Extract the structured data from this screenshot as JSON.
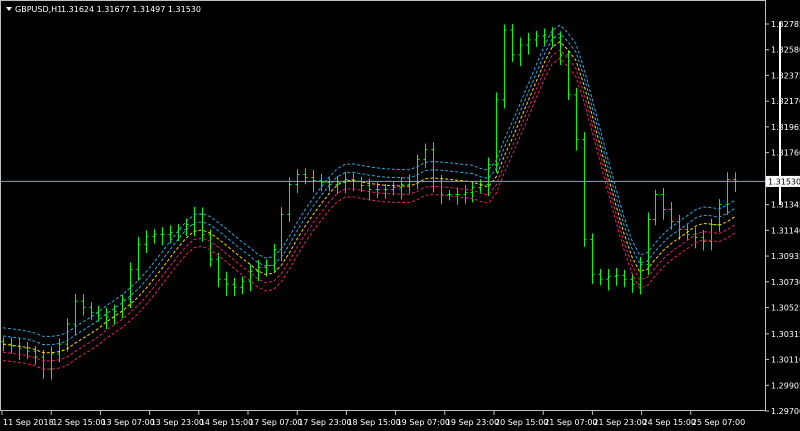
{
  "header": {
    "symbol": "GBPUSD,H1",
    "ohlc": "1.31624 1.31677 1.31497 1.31530",
    "menu_icon": "triangle-down-icon"
  },
  "colors": {
    "background": "#000000",
    "bars": "#00ff00",
    "moving_average": "#ffd700",
    "upper_envelope": "#29a8e0",
    "lower_envelope": "#e0245e",
    "current_price_line": "#8fa3b8",
    "axis": "#c0c0c0"
  },
  "chart_data": {
    "type": "bar",
    "title": "GBPUSD,H1",
    "ylim": [
      1.297,
      1.32785
    ],
    "yticks": [
      "1.32785",
      "1.32580",
      "1.32375",
      "1.32170",
      "1.31965",
      "1.31760",
      "1.31345",
      "1.31140",
      "1.30935",
      "1.30730",
      "1.30525",
      "1.30315",
      "1.30110",
      "1.29905",
      "1.29700"
    ],
    "current_price": "1.31530",
    "xticks": [
      "11 Sep 2018",
      "12 Sep 15:00",
      "13 Sep 07:00",
      "13 Sep 23:00",
      "14 Sep 15:00",
      "17 Sep 07:00",
      "17 Sep 23:00",
      "18 Sep 15:00",
      "19 Sep 07:00",
      "19 Sep 23:00",
      "20 Sep 15:00",
      "21 Sep 07:00",
      "21 Sep 23:00",
      "24 Sep 15:00",
      "25 Sep 07:00"
    ],
    "grid": false,
    "series": [
      {
        "type": "ohlc-bars",
        "close": [
          1.30233,
          1.30217,
          1.30201,
          1.30177,
          1.3013,
          1.30034,
          1.30154,
          1.30233,
          1.30392,
          1.30575,
          1.30527,
          1.30487,
          1.30464,
          1.30448,
          1.30495,
          1.30591,
          1.30829,
          1.31028,
          1.31092,
          1.31108,
          1.31108,
          1.31123,
          1.31147,
          1.31187,
          1.31267,
          1.31108,
          1.30909,
          1.3075,
          1.3071,
          1.30686,
          1.30734,
          1.30813,
          1.30845,
          1.30861,
          1.30988,
          1.31267,
          1.31505,
          1.31585,
          1.31561,
          1.31537,
          1.31521,
          1.31505,
          1.31521,
          1.31545,
          1.31529,
          1.31497,
          1.31465,
          1.31465,
          1.31465,
          1.31481,
          1.31505,
          1.31529,
          1.31704,
          1.31783,
          1.31529,
          1.31426,
          1.31426,
          1.31426,
          1.31441,
          1.31481,
          1.31505,
          1.31664,
          1.32181,
          1.32737,
          1.32539,
          1.32618,
          1.32658,
          1.3269,
          1.32698,
          1.32674,
          1.32539,
          1.32221,
          1.31863,
          1.31068,
          1.3079,
          1.3075,
          1.30774,
          1.30782,
          1.3075,
          1.3071,
          1.30869,
          1.31227,
          1.31426,
          1.31306,
          1.31211,
          1.31147,
          1.31108,
          1.31084,
          1.31052,
          1.31187,
          1.31346,
          1.31545,
          1.3153
        ]
      }
    ]
  }
}
